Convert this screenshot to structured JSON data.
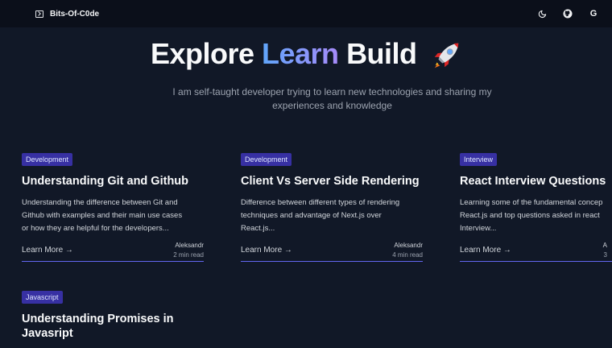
{
  "nav": {
    "brand": "Bits-Of-C0de",
    "icons": [
      "terminal-icon",
      "moon-icon",
      "github-icon",
      "google-icon"
    ],
    "google_letter": "G"
  },
  "hero": {
    "title_part1": "Explore",
    "title_part2": "Learn",
    "title_part3": "Build",
    "emoji": "rocket",
    "subtitle": "I am self-taught developer trying to learn new technologies and sharing my experiences and knowledge"
  },
  "colors": {
    "background": "#111827",
    "navbar": "#0b0f1a",
    "badge": "#3730a3",
    "accent_start": "#60a5fa",
    "accent_end": "#a78bfa",
    "underline": "#6366f1"
  },
  "posts": [
    {
      "tag": "Development",
      "title": "Understanding Git and Github",
      "desc_lines": [
        "Understanding the difference between Git and",
        "Github with examples and their main use cases",
        "or how they are helpful for the developers..."
      ],
      "cta": "Learn More →",
      "author": "Aleksandr",
      "read_time": "2 min read"
    },
    {
      "tag": "Development",
      "title": "Client Vs Server Side Rendering",
      "desc_lines": [
        "Difference between different types of rendering",
        "techniques and advantage of Next.js over",
        "React.js..."
      ],
      "cta": "Learn More →",
      "author": "Aleksandr",
      "read_time": "4 min read"
    },
    {
      "tag": "Interview",
      "title": "React Interview Questions",
      "desc_lines": [
        "Learning some of the fundamental concep",
        "React.js and top questions asked in react",
        "Interview..."
      ],
      "cta": "Learn More →",
      "author": "A",
      "read_time": "3"
    },
    {
      "tag": "Javascript",
      "title_lines": [
        "Understanding Promises in",
        "Javasript"
      ]
    }
  ]
}
